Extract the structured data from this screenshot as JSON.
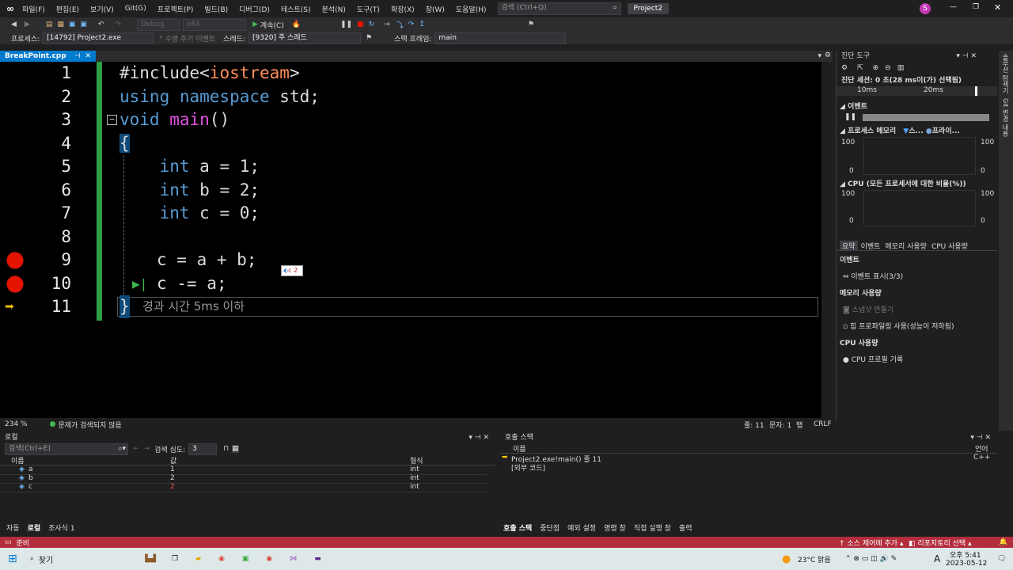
{
  "menu": [
    "파일(F)",
    "편집(E)",
    "보기(V)",
    "Git(G)",
    "프로젝트(P)",
    "빌드(B)",
    "디버그(D)",
    "테스트(S)",
    "분석(N)",
    "도구(T)",
    "확장(X)",
    "창(W)",
    "도움말(H)"
  ],
  "search": {
    "placeholder": "검색 (Ctrl+Q)"
  },
  "project_title": "Project2",
  "user_initial": "S",
  "toolbar": {
    "config": "Debug",
    "platform": "x64",
    "continue_label": "계속(C)"
  },
  "debug_location": {
    "process_label": "프로세스:",
    "process_value": "[14792] Project2.exe",
    "lifecycle_label": "수명 주기 이벤트",
    "thread_label": "스레드:",
    "thread_value": "[9320] 주 스레드",
    "frame_label": "스택 프레임:",
    "frame_value": "main"
  },
  "tab": {
    "name": "BreakPoint.cpp"
  },
  "code": {
    "include_hash": "#include<",
    "include_lib": "iostream",
    "include_end": ">",
    "using_kw": "using namespace",
    "using_rest": " std;",
    "void_kw": "void ",
    "main_fn": "main",
    "main_rest": "()",
    "open_brace": "{",
    "int_kw": "int",
    "a_decl": " a = 1;",
    "b_decl": " b = 2;",
    "c_decl": " c = 0;",
    "sum_line": "c = a + b;",
    "sub_line": "c -= a;",
    "close_brace": "}",
    "elapsed": "경과 시간 5ms 이하",
    "datatip": "c 2"
  },
  "line_numbers": [
    "1",
    "2",
    "3",
    "4",
    "5",
    "6",
    "7",
    "8",
    "9",
    "10",
    "11"
  ],
  "editor_status": {
    "zoom": "234 %",
    "issues": "문제가 검색되지 않음",
    "line": "줄: 11",
    "col": "문자: 1",
    "tab": "탭",
    "eol": "CRLF"
  },
  "diagnostics": {
    "title": "진단 도구",
    "session": "진단 세션: 0 초(28 ms이(가) 선택됨)",
    "ticks": [
      "10ms",
      "20ms"
    ],
    "events_header": "이벤트",
    "memory_header": "프로세스 메모리",
    "memory_legend": [
      "스...",
      "프라이..."
    ],
    "cpu_header": "CPU (모든 프로세서에 대한 비율(%))",
    "axis_values": [
      "100",
      "0"
    ],
    "tabs": [
      "요약",
      "이벤트",
      "메모리 사용량",
      "CPU 사용량"
    ],
    "summary_events_title": "이벤트",
    "summary_events_item": "이벤트 표시(3/3)",
    "summary_memory_title": "메모리 사용량",
    "summary_memory_items": [
      "스냅샷 만들기",
      "힙 프로파일링 사용(성능이 저하됨)"
    ],
    "summary_cpu_title": "CPU 사용량",
    "summary_cpu_item": "CPU 프로필 기록",
    "side_tabs": [
      "솔루션 탐색기",
      "Git 변경 내용"
    ]
  },
  "locals": {
    "title": "로컬",
    "search_placeholder": "검색(Ctrl+E)",
    "depth_label": "검색 심도:",
    "depth_value": "3",
    "columns": [
      "이름",
      "값",
      "형식"
    ],
    "rows": [
      {
        "name": "a",
        "value": "1",
        "type": "int"
      },
      {
        "name": "b",
        "value": "2",
        "type": "int"
      },
      {
        "name": "c",
        "value": "2",
        "type": "int"
      }
    ],
    "tabs": [
      "자동",
      "로컬",
      "조사식 1"
    ]
  },
  "callstack": {
    "title": "호출 스택",
    "columns": [
      "이름",
      "언어"
    ],
    "rows": [
      {
        "name": "Project2.exe!main() 줄 11",
        "lang": "C++"
      },
      {
        "name": "[외부 코드]",
        "lang": ""
      }
    ],
    "tabs": [
      "호출 스택",
      "중단점",
      "예외 설정",
      "명령 창",
      "직접 실행 창",
      "출력"
    ]
  },
  "status": {
    "ready": "준비",
    "source_control": "소스 제어에 추가",
    "repo": "리포지토리 선택"
  },
  "taskbar": {
    "search": "찾기",
    "weather": "23°C 맑음",
    "lang": "A",
    "time": "오후 5:41",
    "date": "2023-05-12"
  },
  "colors": {
    "accent": "#007acc",
    "status": "#b32d3c",
    "breakpoint": "#e51400",
    "keyword": "#569cd6",
    "function": "#e052e0"
  }
}
